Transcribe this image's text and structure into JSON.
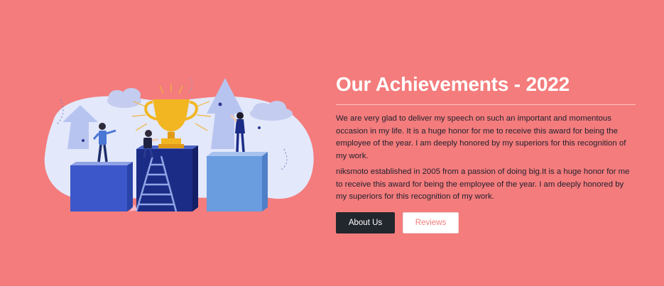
{
  "section": {
    "title": "Our Achievements - 2022",
    "paragraphs": [
      "We are very glad to deliver my speech on such an important and momentous occasion in my life. It is a huge honor for me to receive this award for being the employee of the year. I am deeply honored by my superiors for this recognition of my work.",
      "niksmoto established in 2005 from a passion of doing big.It is a huge honor for me to receive this award for being the employee of the year. I am deeply honored by my superiors for this recognition of my work."
    ],
    "buttons": {
      "primary": "About Us",
      "secondary": "Reviews"
    }
  },
  "illustration": {
    "icon": "achievement-podium-trophy-illustration"
  },
  "colors": {
    "background": "#f47c7c",
    "primary_button": "#22262d",
    "secondary_button_text": "#f47c7c",
    "title": "#ffffff"
  }
}
